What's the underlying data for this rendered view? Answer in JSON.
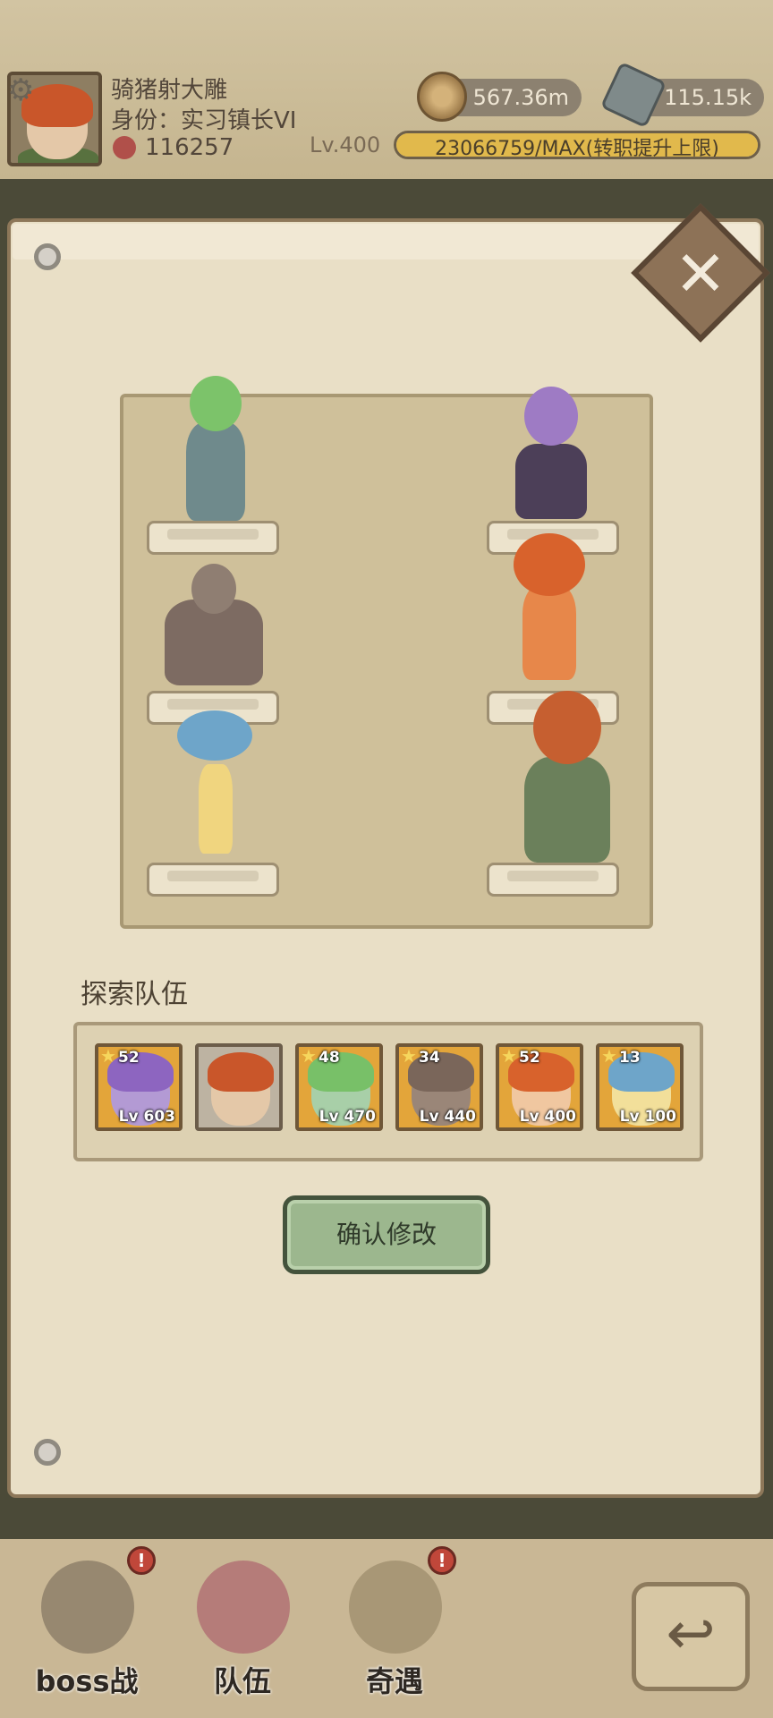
{
  "header": {
    "player_name": "骑猪射大雕",
    "rank_label": "身份：实习镇长VI",
    "power": "116257",
    "level": "Lv.400",
    "gold": "567.36m",
    "gems": "115.15k",
    "xp_text": "23066759/MAX(转职提升上限)"
  },
  "formation": {
    "left_column": [
      "green-haired-golem-girl",
      "rock-golem",
      "mushroom-girl"
    ],
    "right_column": [
      "purple-octopus-girl",
      "fire-girl",
      "archer-boy"
    ]
  },
  "team": {
    "title": "探索队伍",
    "slots": [
      {
        "stars": "52",
        "level": "Lv 603"
      },
      {
        "stars": "",
        "level": ""
      },
      {
        "stars": "48",
        "level": "Lv 470"
      },
      {
        "stars": "34",
        "level": "Lv 440"
      },
      {
        "stars": "52",
        "level": "Lv 400"
      },
      {
        "stars": "13",
        "level": "Lv 100"
      }
    ]
  },
  "confirm_label": "确认修改",
  "nav": {
    "boss": "boss战",
    "team": "队伍",
    "adventure": "奇遇",
    "badge": "!"
  },
  "colors": {
    "parchment": "#e9dfc6",
    "gold_slot": "#e3a53a",
    "confirm_green": "#9cb78e"
  }
}
